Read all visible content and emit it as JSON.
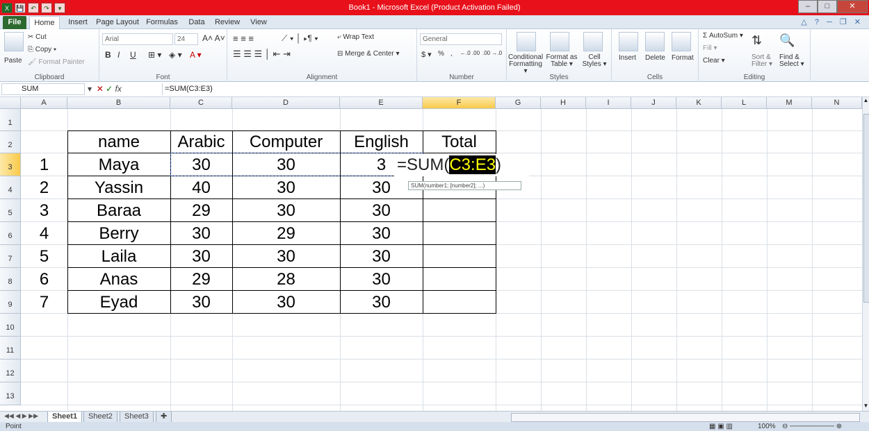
{
  "window": {
    "title": "Book1 - Microsoft Excel (Product Activation Failed)",
    "title_bar_color": "#e8111b",
    "controls": {
      "minimize": "–",
      "maximize": "□",
      "close": "✕"
    }
  },
  "quick_access": {
    "excel_icon": "X",
    "save_icon": "💾",
    "undo_icon": "↶",
    "redo_icon": "↷",
    "customize_icon": "▾"
  },
  "tabs": [
    "File",
    "Home",
    "Insert",
    "Page Layout",
    "Formulas",
    "Data",
    "Review",
    "View"
  ],
  "ribbon": {
    "clipboard": {
      "label": "Clipboard",
      "paste": "Paste",
      "cut": "Cut",
      "copy": "Copy ▾",
      "format_painter": "Format Painter"
    },
    "font": {
      "label": "Font",
      "font_name": "Arial",
      "font_size": "24",
      "bold": "B",
      "italic": "I",
      "underline": "U"
    },
    "alignment": {
      "label": "Alignment",
      "wrap_text": "Wrap Text",
      "merge_center": "Merge & Center ▾"
    },
    "number": {
      "label": "Number",
      "format": "General",
      "percent": "%",
      "comma": ",",
      "inc_decimal": "←.0 .00",
      "dec_decimal": ".00 →.0"
    },
    "styles": {
      "label": "Styles",
      "conditional": "Conditional Formatting ▾",
      "format_table": "Format as Table ▾",
      "cell_styles": "Cell Styles ▾"
    },
    "cells": {
      "label": "Cells",
      "insert": "Insert",
      "delete": "Delete",
      "format": "Format"
    },
    "editing": {
      "label": "Editing",
      "autosum": "Σ AutoSum ▾",
      "fill": "Fill ▾",
      "clear": "Clear ▾",
      "sort_filter": "Sort & Filter ▾",
      "find_select": "Find & Select ▾"
    }
  },
  "formula_bar": {
    "name_box": "SUM",
    "fx": "fx",
    "formula": "=SUM(C3:E3)"
  },
  "columns": [
    "A",
    "B",
    "C",
    "D",
    "E",
    "F",
    "G",
    "H",
    "I",
    "J",
    "K",
    "L",
    "M",
    "N"
  ],
  "selected_column": "F",
  "rows": [
    "1",
    "2",
    "3",
    "4",
    "5",
    "6",
    "7",
    "8",
    "9",
    "10",
    "11",
    "12",
    "13"
  ],
  "selected_row": "3",
  "table": {
    "headers": [
      "name",
      "Arabic",
      "Computer",
      "English",
      "Total"
    ],
    "data": [
      [
        "1",
        "Maya",
        "30",
        "30",
        "3"
      ],
      [
        "2",
        "Yassin",
        "40",
        "30",
        "30"
      ],
      [
        "3",
        "Baraa",
        "29",
        "30",
        "30"
      ],
      [
        "4",
        "Berry",
        "30",
        "29",
        "30"
      ],
      [
        "5",
        "Laila",
        "30",
        "30",
        "30"
      ],
      [
        "6",
        "Anas",
        "29",
        "28",
        "30"
      ],
      [
        "7",
        "Eyad",
        "30",
        "30",
        "30"
      ]
    ]
  },
  "editing_cell": {
    "prefix": "=SUM(",
    "range": "C3:E3",
    "suffix": ")",
    "highlight_color": "#ffff00"
  },
  "tooltip": {
    "text": "SUM(number1; [number2]; ...)"
  },
  "sheets": [
    "Sheet1",
    "Sheet2",
    "Sheet3"
  ],
  "active_sheet": "Sheet1",
  "status": {
    "mode": "Point",
    "zoom": "100%"
  }
}
